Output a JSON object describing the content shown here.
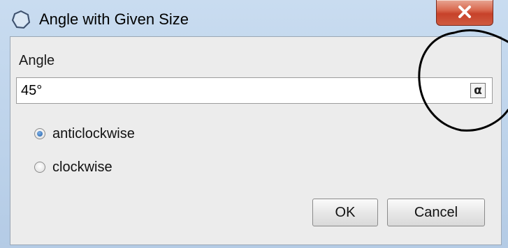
{
  "window": {
    "title": "Angle with Given Size",
    "close_label": "close"
  },
  "form": {
    "angle_label": "Angle",
    "angle_value": "45°",
    "symbol_button_label": "α",
    "options": [
      {
        "label": "anticlockwise",
        "selected": true
      },
      {
        "label": "clockwise",
        "selected": false
      }
    ]
  },
  "buttons": {
    "ok_label": "OK",
    "cancel_label": "Cancel"
  },
  "colors": {
    "titlebar": "#c9dcf0",
    "close_button": "#c7422a",
    "panel": "#ececec",
    "radio_selected": "#1f5fa8",
    "annotation_stroke": "#000000"
  },
  "icons": [
    "dialog-shape-icon",
    "close-x-icon",
    "alpha-symbol-icon"
  ]
}
